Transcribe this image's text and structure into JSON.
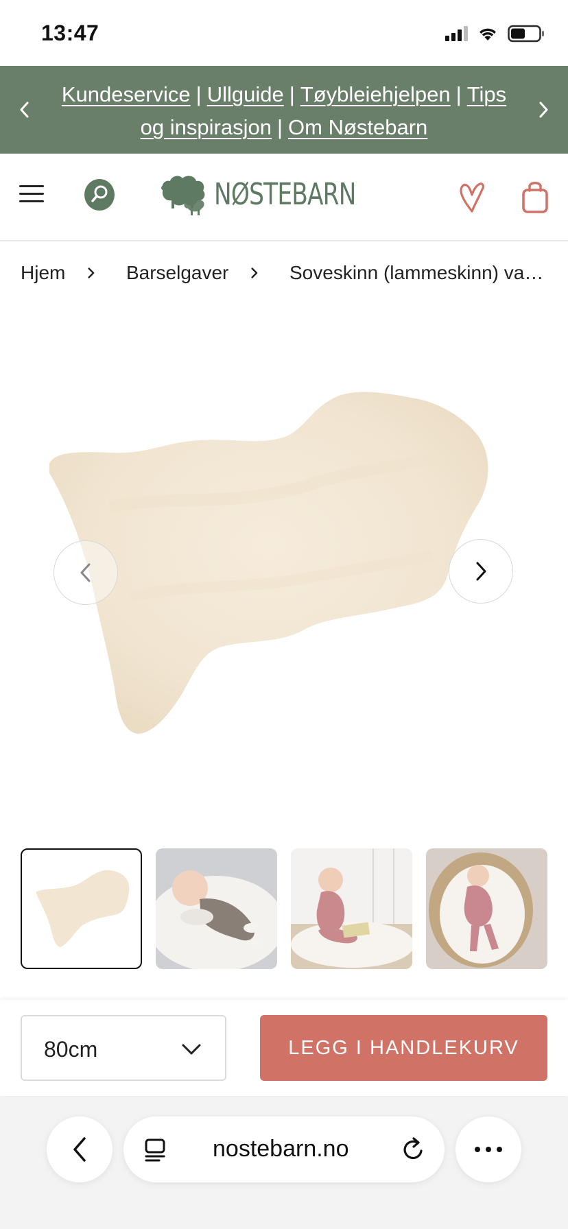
{
  "status_bar": {
    "time": "13:47",
    "icons": [
      "cellular-signal-icon",
      "wifi-icon",
      "battery-icon"
    ]
  },
  "announcement": {
    "links": [
      {
        "label": "Kundeservice"
      },
      {
        "label": "Ullguide"
      },
      {
        "label": "Tøybleiehjelpen"
      },
      {
        "label": "Tips og inspirasjon"
      },
      {
        "label": "Om Nøstebarn"
      }
    ],
    "separator": "|",
    "background_color": "#697f69"
  },
  "header": {
    "logo_text": "NØSTEBARN",
    "brand_color": "#5e7a63",
    "accent_color": "#d17266",
    "icons": [
      "menu-icon",
      "search-icon",
      "sheep-logo-icon",
      "heart-icon",
      "shopping-bag-icon"
    ]
  },
  "breadcrumb": {
    "items": [
      {
        "label": "Hjem"
      },
      {
        "label": "Barselgaver"
      },
      {
        "label": "Soveskinn (lammeskinn) vaskb..."
      }
    ]
  },
  "gallery": {
    "main_image": "sheepskin-rug",
    "prev_icon": "chevron-left-icon",
    "next_icon": "chevron-right-icon",
    "thumbnails": [
      {
        "name": "sheepskin-rug",
        "active": true
      },
      {
        "name": "baby-on-sheepskin-grey-outfit",
        "active": false
      },
      {
        "name": "baby-sitting-pink-outfit-with-book",
        "active": false
      },
      {
        "name": "baby-in-basket-pink-outfit",
        "active": false
      }
    ]
  },
  "purchase": {
    "size_selected": "80cm",
    "add_to_cart_label": "LEGG I HANDLEKURV",
    "button_color": "#d17266"
  },
  "browser": {
    "url": "nostebarn.no",
    "icons": [
      "back-chevron-icon",
      "tabs-icon",
      "reload-icon",
      "more-dots-icon"
    ]
  }
}
